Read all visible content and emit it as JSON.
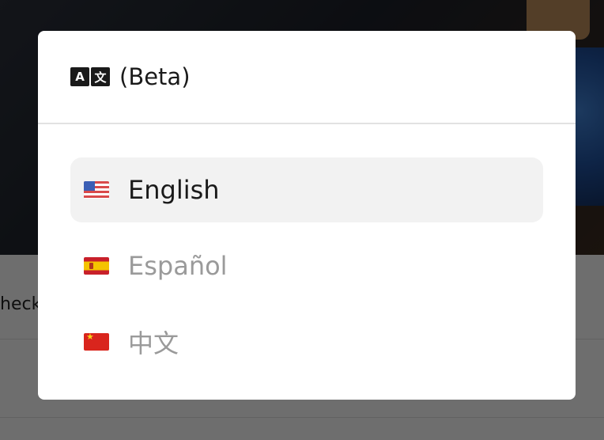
{
  "background": {
    "partial_text": "heck"
  },
  "modal": {
    "title": "(Beta)",
    "icon": "translate-icon",
    "icon_glyphs": [
      "A",
      "文"
    ],
    "languages": [
      {
        "label": "English",
        "flag": "us-flag-icon",
        "selected": true
      },
      {
        "label": "Español",
        "flag": "spain-flag-icon",
        "selected": false
      },
      {
        "label": "中文",
        "flag": "china-flag-icon",
        "selected": false
      }
    ]
  },
  "colors": {
    "selected_bg": "#f2f2f2",
    "selected_text": "#1a1a1a",
    "unselected_text": "#9a9a9a"
  }
}
